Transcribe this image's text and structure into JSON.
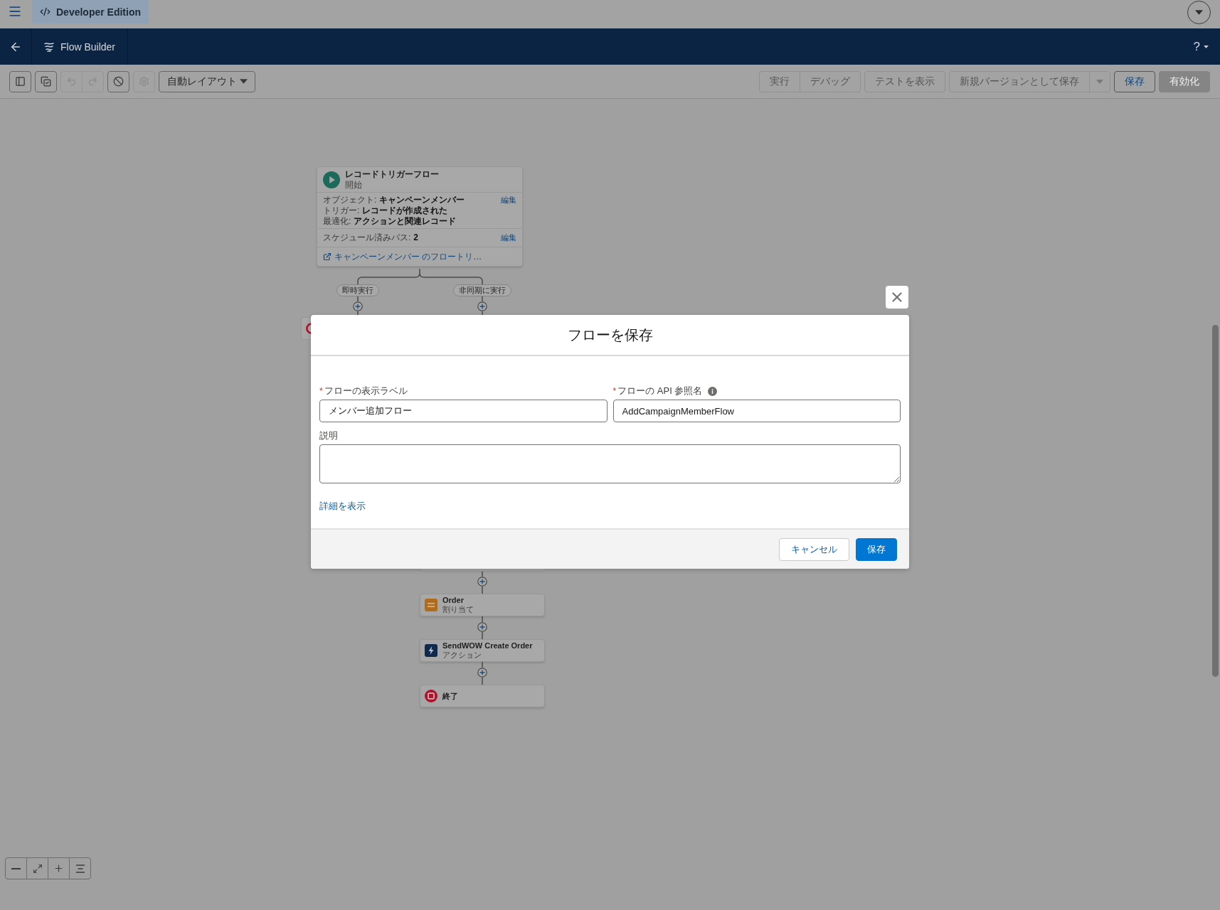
{
  "top_bar": {
    "edition_label": "Developer Edition"
  },
  "nav_bar": {
    "app_name": "Flow Builder",
    "help_label": "?"
  },
  "toolbar": {
    "icon_groups": [
      {
        "buttons": [
          {
            "kind": "panel",
            "disabled": false
          }
        ]
      },
      {
        "buttons": [
          {
            "kind": "manager",
            "disabled": false
          }
        ]
      },
      {
        "buttons": [
          {
            "kind": "undo",
            "disabled": true
          },
          {
            "kind": "redo",
            "disabled": true
          }
        ]
      },
      {
        "buttons": [
          {
            "kind": "cancel",
            "disabled": false
          }
        ]
      },
      {
        "buttons": [
          {
            "kind": "settings",
            "disabled": true
          }
        ]
      }
    ],
    "layout_select": {
      "value": "自動レイアウト"
    },
    "action_groups": [
      {
        "buttons": [
          {
            "label": "実行",
            "kind": "neutral",
            "disabled": true
          },
          {
            "label": "デバッグ",
            "kind": "neutral",
            "disabled": true
          }
        ]
      },
      {
        "buttons": [
          {
            "label": "テストを表示",
            "kind": "neutral",
            "disabled": true
          }
        ]
      },
      {
        "buttons": [
          {
            "label": "新規バージョンとして保存",
            "kind": "neutral",
            "disabled": true
          }
        ],
        "menu": {
          "disabled": true
        }
      },
      {
        "buttons": [
          {
            "label": "保存",
            "kind": "neutral",
            "disabled": false
          }
        ]
      },
      {
        "buttons": [
          {
            "label": "有効化",
            "kind": "brand",
            "disabled": true
          }
        ]
      }
    ]
  },
  "canvas": {
    "start_node": {
      "title": "レコードトリガーフロー",
      "subtitle": "開始",
      "details": [
        {
          "label": "オブジェクト:",
          "value": "キャンペーンメンバー"
        },
        {
          "label": "トリガー:",
          "value": "レコードが作成された"
        },
        {
          "label": "最適化:",
          "value": "アクションと関連レコード"
        }
      ],
      "details_action": "編集",
      "schedule": {
        "label": "スケジュール済みパス:",
        "value": "2",
        "action": "編集"
      },
      "link": "キャンペーンメンバー のフロートリ…"
    },
    "branches": [
      {
        "label": "即時実行",
        "covered_node": {
          "kind": "end"
        }
      },
      {
        "label": "非同期に実行",
        "covered_node": {
          "kind": "plain"
        },
        "nodes": [
          {
            "kind": "assignment",
            "title": "Order",
            "subtitle": "割り当て"
          },
          {
            "kind": "action",
            "title": "SendWOW Create Order",
            "subtitle": "アクション"
          },
          {
            "kind": "end",
            "title": "終了"
          }
        ]
      }
    ]
  },
  "modal": {
    "title": "フローを保存",
    "fields": [
      {
        "kind": "input",
        "label": "フローの表示ラベル",
        "required_mark": "*",
        "value": "メンバー追加フロー",
        "info": false
      },
      {
        "kind": "input",
        "label": "フローの API 参照名",
        "required_mark": "*",
        "value": "AddCampaignMemberFlow",
        "info": true
      },
      {
        "kind": "textarea",
        "label": "説明",
        "info": false
      }
    ],
    "details_link": "詳細を表示",
    "buttons": [
      {
        "label": "キャンセル",
        "kind": "neutral"
      },
      {
        "label": "保存",
        "kind": "brand"
      }
    ]
  }
}
